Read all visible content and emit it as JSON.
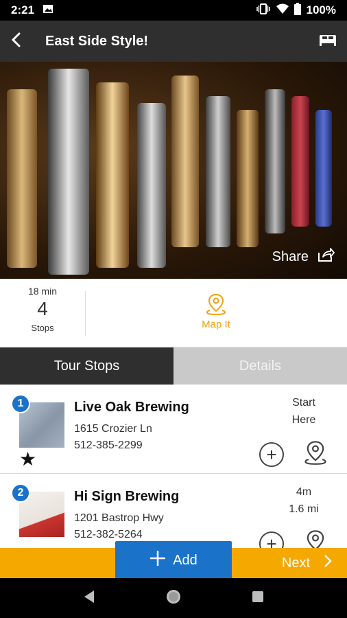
{
  "status": {
    "time": "2:21",
    "battery": "100%"
  },
  "header": {
    "title": "East Side Style!"
  },
  "hero": {
    "share_label": "Share"
  },
  "stats": {
    "duration": "18 min",
    "stop_count": "4",
    "stops_label": "Stops",
    "map_label": "Map It"
  },
  "tabs": [
    {
      "label": "Tour Stops"
    },
    {
      "label": "Details"
    }
  ],
  "stops": [
    {
      "number": "1",
      "name": "Live Oak Brewing",
      "address": "1615 Crozier Ln",
      "phone": "512-385-2299",
      "meta_line1": "Start",
      "meta_line2": "Here"
    },
    {
      "number": "2",
      "name": "Hi Sign Brewing",
      "address": "1201 Bastrop Hwy",
      "phone": "512-382-5264",
      "meta_line1": "4m",
      "meta_line2": "1.6 mi"
    }
  ],
  "footer": {
    "add_label": "Add",
    "next_label": "Next"
  },
  "colors": {
    "accent": "#f5a800",
    "primary_blue": "#1a73c8",
    "dark": "#2f2f2f",
    "map_orange": "#f0a30a"
  }
}
